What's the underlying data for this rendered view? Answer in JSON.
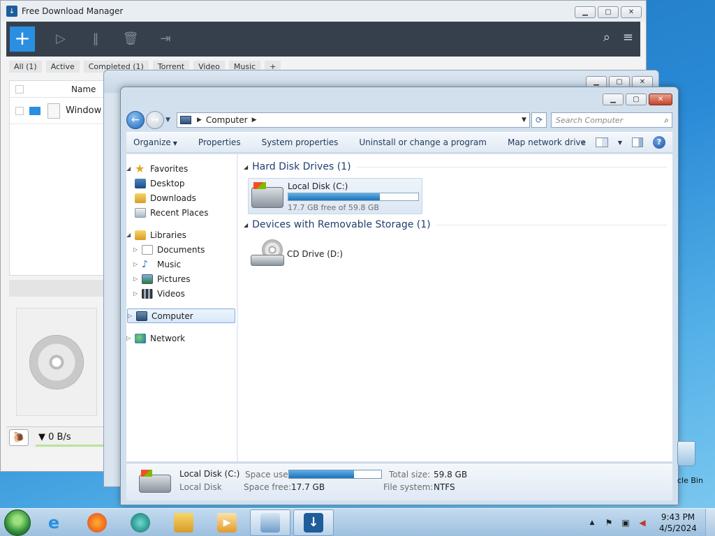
{
  "fdm": {
    "title": "Free Download Manager",
    "tabs": [
      "All (1)",
      "Active",
      "Completed (1)",
      "Torrent",
      "Video",
      "Music"
    ],
    "add_tab": "+",
    "column_name": "Name",
    "row_name": "Window",
    "speed": "▼ 0 B/s"
  },
  "explorer": {
    "address": "Computer",
    "search_placeholder": "Search Computer",
    "commands": {
      "organize": "Organize",
      "properties": "Properties",
      "system_properties": "System properties",
      "uninstall": "Uninstall or change a program",
      "map_network": "Map network drive",
      "more": "»"
    },
    "nav": {
      "favorites": "Favorites",
      "desktop": "Desktop",
      "downloads": "Downloads",
      "recent": "Recent Places",
      "libraries": "Libraries",
      "documents": "Documents",
      "music": "Music",
      "pictures": "Pictures",
      "videos": "Videos",
      "computer": "Computer",
      "network": "Network"
    },
    "groups": {
      "hdd": "Hard Disk Drives (1)",
      "removable": "Devices with Removable Storage (1)"
    },
    "local_disk": {
      "name": "Local Disk (C:)",
      "free": "17.7 GB free of 59.8 GB",
      "used_fraction": 0.704
    },
    "cd_drive": {
      "name": "CD Drive (D:)"
    },
    "details": {
      "name": "Local Disk (C:)",
      "type": "Local Disk",
      "space_used_label": "Space used:",
      "space_free_label": "Space free:",
      "space_free": "17.7 GB",
      "total_size_label": "Total size:",
      "total_size": "59.8 GB",
      "file_system_label": "File system:",
      "file_system": "NTFS"
    }
  },
  "desktop": {
    "recycle_bin": "cle Bin"
  },
  "taskbar": {
    "time": "9:43 PM",
    "date": "4/5/2024"
  },
  "colors": {
    "accent": "#2a8fe0",
    "fdm_toolbar": "#36404d",
    "progress": "#1f73b8"
  }
}
